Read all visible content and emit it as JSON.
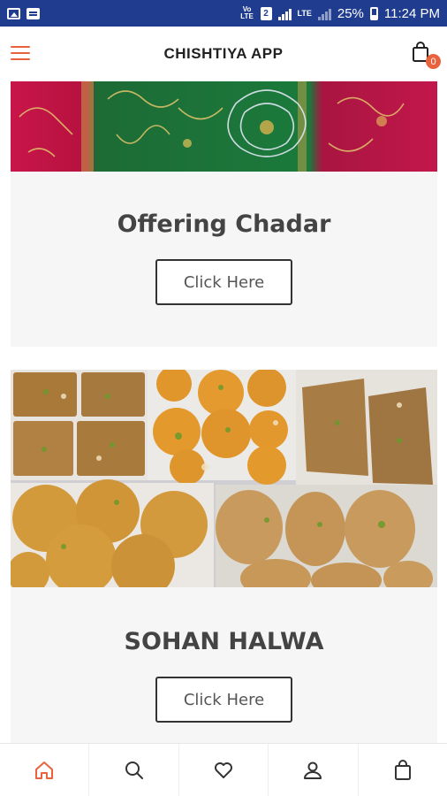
{
  "status_bar": {
    "volte": "Vo LTE",
    "sim_number": "2",
    "network": "LTE",
    "battery": "25%",
    "time": "11:24 PM"
  },
  "header": {
    "title": "CHISHTIYA APP",
    "cart_count": "0"
  },
  "cards": [
    {
      "title": "Offering Chadar",
      "button_label": "Click Here",
      "image": "green-embroidered-chadar-photo"
    },
    {
      "title": "SOHAN HALWA",
      "button_label": "Click Here",
      "image": "sohan-halwa-sweets-photo"
    }
  ],
  "bottom_nav": {
    "items": [
      {
        "icon": "home-icon",
        "active": true
      },
      {
        "icon": "search-icon",
        "active": false
      },
      {
        "icon": "heart-icon",
        "active": false
      },
      {
        "icon": "user-icon",
        "active": false
      },
      {
        "icon": "bag-icon",
        "active": false
      }
    ]
  },
  "colors": {
    "status_bar": "#1f3c8f",
    "accent": "#e8633d",
    "card_bg": "#f6f6f6"
  }
}
